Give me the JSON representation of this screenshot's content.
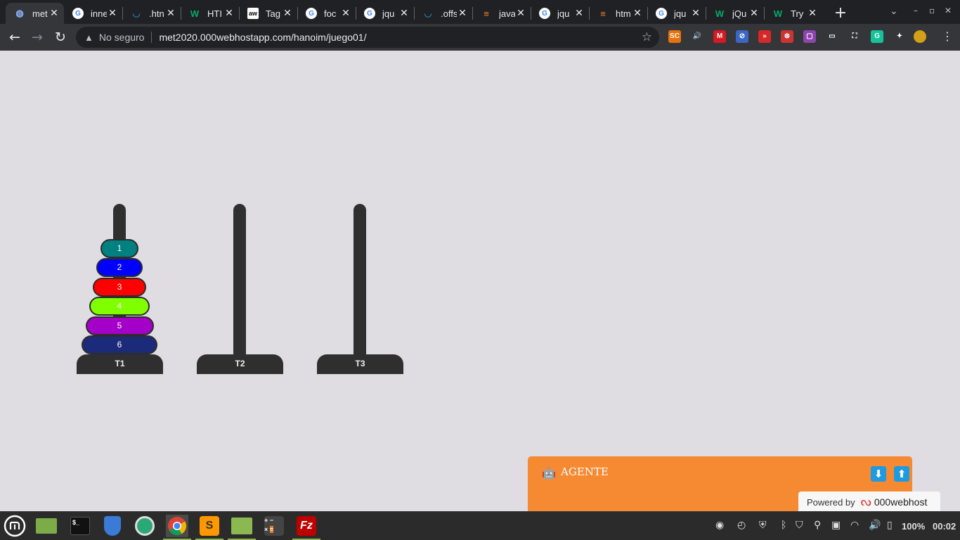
{
  "browser": {
    "tabs": [
      {
        "label": "met",
        "favicon": "globe-icon",
        "active": true
      },
      {
        "label": "inne",
        "favicon": "google-icon"
      },
      {
        "label": ".htn",
        "favicon": "wordpress-icon"
      },
      {
        "label": "HTI",
        "favicon": "w3schools-icon"
      },
      {
        "label": "Tag",
        "favicon": "aw-icon"
      },
      {
        "label": "foc",
        "favicon": "google-icon"
      },
      {
        "label": "jqu",
        "favicon": "google-icon"
      },
      {
        "label": ".offs",
        "favicon": "wordpress-icon"
      },
      {
        "label": "java",
        "favicon": "stackoverflow-icon"
      },
      {
        "label": "jqu",
        "favicon": "google-icon"
      },
      {
        "label": "htm",
        "favicon": "stackoverflow-icon"
      },
      {
        "label": "jqu",
        "favicon": "google-icon"
      },
      {
        "label": "jQu",
        "favicon": "w3schools-icon"
      },
      {
        "label": "Try",
        "favicon": "w3schools-icon"
      }
    ],
    "security_label": "No seguro",
    "url": "met2020.000webhostapp.com/hanoim/juego01/",
    "extensions": [
      {
        "name": "sc-extension-icon",
        "label": "SC",
        "color": "#e8710a"
      },
      {
        "name": "speaker-icon",
        "label": "🔊",
        "color": "transparent"
      },
      {
        "name": "mendeley-icon",
        "label": "M",
        "color": "#d71920"
      },
      {
        "name": "no-tracking-icon",
        "label": "⊘",
        "color": "#3c66c4"
      },
      {
        "name": "fast-forward-icon",
        "label": "»",
        "color": "#d62828"
      },
      {
        "name": "blocker-icon",
        "label": "⊗",
        "color": "#c33"
      },
      {
        "name": "square-ext-icon",
        "label": "▢",
        "color": "#8e44ad"
      },
      {
        "name": "cast-icon",
        "label": "▭",
        "color": "transparent"
      },
      {
        "name": "screenshot-icon",
        "label": "⛶",
        "color": "transparent"
      },
      {
        "name": "grammarly-icon",
        "label": "G",
        "color": "#15c39a"
      },
      {
        "name": "puzzle-icon",
        "label": "✦",
        "color": "transparent"
      }
    ]
  },
  "game": {
    "towers": [
      {
        "label": "T1",
        "disks": [
          {
            "label": "1",
            "color": "#008080"
          },
          {
            "label": "2",
            "color": "#0000ff"
          },
          {
            "label": "3",
            "color": "#ff0000"
          },
          {
            "label": "4",
            "color": "#7fff00"
          },
          {
            "label": "5",
            "color": "#a300c8"
          },
          {
            "label": "6",
            "color": "#1c2a7a"
          }
        ]
      },
      {
        "label": "T2",
        "disks": []
      },
      {
        "label": "T3",
        "disks": []
      }
    ]
  },
  "agent": {
    "title": "AGENTE",
    "down_icon": "⬇",
    "up_icon": "⬆"
  },
  "powered": {
    "label": "Powered by",
    "brand": "000webhost"
  },
  "taskbar": {
    "battery": "100%",
    "time": "00:02"
  }
}
